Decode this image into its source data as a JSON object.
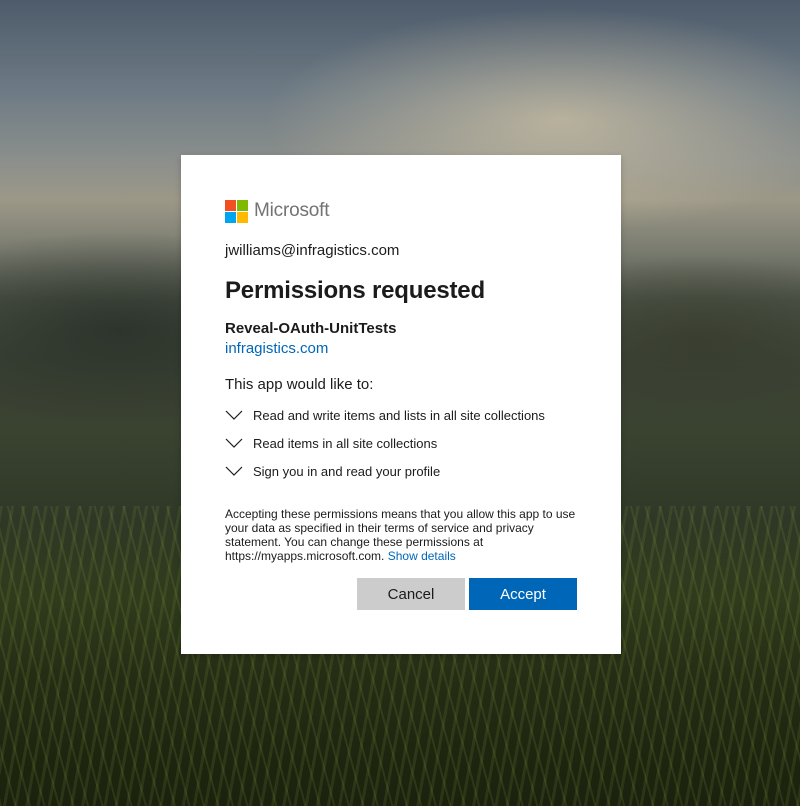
{
  "brand": {
    "name": "Microsoft",
    "logo_colors": [
      "#f25022",
      "#7fba00",
      "#00a4ef",
      "#ffb900"
    ]
  },
  "account": {
    "email": "jwilliams@infragistics.com"
  },
  "dialog": {
    "title": "Permissions requested",
    "app_name": "Reveal-OAuth-UnitTests",
    "app_domain": "infragistics.com",
    "intro": "This app would like to:",
    "permissions": [
      {
        "label": "Read and write items and lists in all site collections",
        "icon": "chevron-down-icon"
      },
      {
        "label": "Read items in all site collections",
        "icon": "chevron-down-icon"
      },
      {
        "label": "Sign you in and read your profile",
        "icon": "chevron-down-icon"
      }
    ],
    "notice": "Accepting these permissions means that you allow this app to use your data as specified in their terms of service and privacy statement. You can change these permissions at https://myapps.microsoft.com.",
    "details_link": "Show details"
  },
  "buttons": {
    "cancel": "Cancel",
    "accept": "Accept"
  },
  "colors": {
    "accent": "#0067b8",
    "cancel_bg": "#cccccc",
    "text": "#1b1b1b"
  }
}
